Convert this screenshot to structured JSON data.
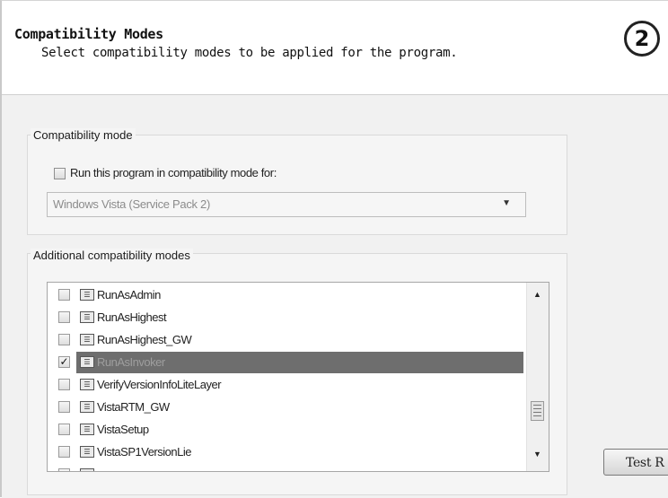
{
  "header": {
    "title": "Compatibility Modes",
    "subtitle": "Select compatibility modes to be applied for the program.",
    "step_number": "2"
  },
  "compat_group": {
    "label": "Compatibility mode",
    "checkbox_label": "Run this program in compatibility mode for:",
    "checkbox_checked": false,
    "os_select": {
      "value": "Windows Vista (Service Pack 2)",
      "enabled": false
    }
  },
  "additional_group": {
    "label": "Additional compatibility modes",
    "items": [
      {
        "label": "RunAsAdmin",
        "checked": false,
        "selected": false
      },
      {
        "label": "RunAsHighest",
        "checked": false,
        "selected": false
      },
      {
        "label": "RunAsHighest_GW",
        "checked": false,
        "selected": false
      },
      {
        "label": "RunAsInvoker",
        "checked": true,
        "selected": true
      },
      {
        "label": "VerifyVersionInfoLiteLayer",
        "checked": false,
        "selected": false
      },
      {
        "label": "VistaRTM_GW",
        "checked": false,
        "selected": false
      },
      {
        "label": "VistaSetup",
        "checked": false,
        "selected": false
      },
      {
        "label": "VistaSP1VersionLie",
        "checked": false,
        "selected": false
      }
    ]
  },
  "buttons": {
    "test_label": "Test R"
  }
}
